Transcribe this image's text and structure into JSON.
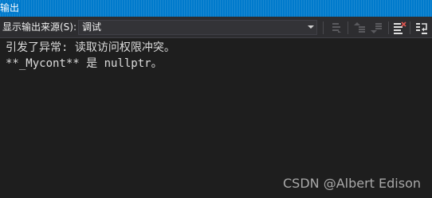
{
  "window": {
    "title": "输出"
  },
  "toolbar": {
    "source_label": "显示输出来源(S):",
    "source_value": "调试",
    "buttons": [
      {
        "name": "find-message-in-code-button",
        "icon": "goto-source-icon",
        "enabled": false
      },
      {
        "name": "previous-message-button",
        "icon": "previous-message-icon",
        "enabled": false
      },
      {
        "name": "next-message-button",
        "icon": "next-message-icon",
        "enabled": false
      },
      {
        "name": "clear-all-button",
        "icon": "clear-all-icon",
        "enabled": true
      },
      {
        "name": "word-wrap-button",
        "icon": "word-wrap-icon",
        "enabled": true
      }
    ]
  },
  "output": {
    "lines": [
      "引发了异常: 读取访问权限冲突。",
      "**_Mycont** 是 nullptr。"
    ]
  },
  "watermark": "CSDN @Albert Edison",
  "colors": {
    "title_bar": "#007acc",
    "toolbar_bg": "#2d2d30",
    "output_bg": "#1e1e1e",
    "output_text": "#dcdcdc",
    "clear_icon_accent": "#d9534f"
  }
}
